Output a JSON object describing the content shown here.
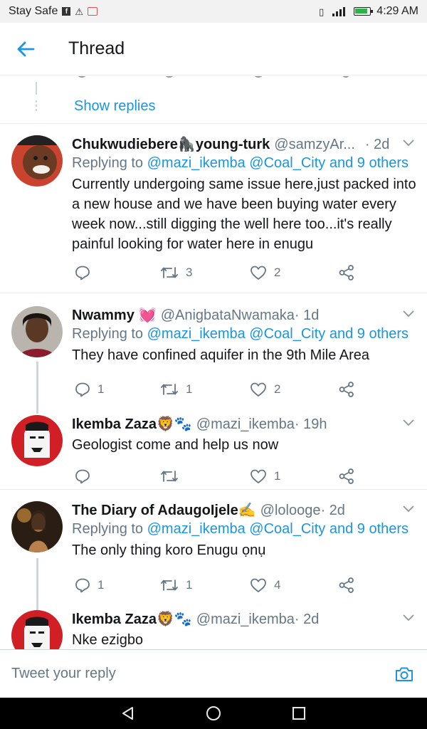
{
  "status_bar": {
    "carrier": "Stay Safe",
    "time": "4:29 AM",
    "colors": {
      "background": "#f2f2f2",
      "battery": "#2fb34a"
    }
  },
  "header": {
    "title": "Thread",
    "accent": "#1b95e0"
  },
  "show_replies": "Show replies",
  "tweets": [
    {
      "name": "Chukwudiebere",
      "name_suffix": "young-turk",
      "name_emoji": "🦍",
      "handle": "@samzyAr...",
      "time": " · 2d",
      "replying_prefix": "Replying to ",
      "replying_mentions": "@mazi_ikemba @Coal_City and 9 others",
      "text": "Currently undergoing same issue here,just packed into a new house and we have been buying water every  week now...still digging the well here too...it's really painful  looking for water here in enugu",
      "replies": "",
      "retweets": "3",
      "likes": "2"
    },
    {
      "name": "Nwammy",
      "name_emoji": "💓",
      "handle": "@AnigbataNwamaka",
      "time": " · 1d",
      "replying_prefix": "Replying to ",
      "replying_mentions": "@mazi_ikemba @Coal_City and 9 others",
      "text": "They have confined aquifer in the 9th Mile Area",
      "replies": "1",
      "retweets": "1",
      "likes": "2"
    },
    {
      "name": "Ikemba Zaza",
      "name_emoji": "🦁🐾",
      "handle": "@mazi_ikemba",
      "time": " · 19h",
      "text": "Geologist come and help us now",
      "replies": "",
      "retweets": "",
      "likes": "1"
    },
    {
      "name": "The Diary of AdaugoIjele",
      "name_emoji": "✍️",
      "handle": "@lolooge",
      "time": " · 2d",
      "replying_prefix": "Replying to ",
      "replying_mentions": "@mazi_ikemba @Coal_City and 9 others",
      "text": "The only thing koro Enugu ọnụ",
      "replies": "1",
      "retweets": "1",
      "likes": "4"
    },
    {
      "name": "Ikemba Zaza",
      "name_emoji": "🦁🐾",
      "handle": "@mazi_ikemba",
      "time": " · 2d",
      "text": "Nke ezigbo"
    }
  ],
  "reply_bar": {
    "placeholder": "Tweet your reply"
  }
}
